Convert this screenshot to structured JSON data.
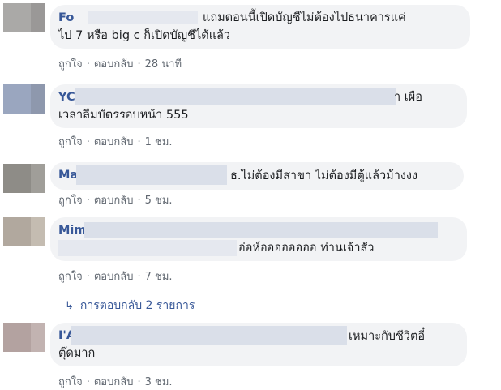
{
  "actions": {
    "like": "ถูกใจ",
    "reply": "ตอบกลับ",
    "separator": "·"
  },
  "comments": [
    {
      "author": "Fo",
      "lines": [
        "แถมตอนนี้เปิดบัญชีไม่ต้องไปธนาคารแค่",
        "ไป 7 หรือ big c ก็เปิดบัญชีได้แล้ว"
      ],
      "time": "28 นาที"
    },
    {
      "author": "YC",
      "lines": [
        "า เผื่อ",
        "เวลาลืมบัตรรอบหน้า 555"
      ],
      "time": "1 ชม."
    },
    {
      "author": "Ma",
      "lines": [
        "ธ.ไม่ต้องมีสาขา ไม่ต้องมีตู้แล้วม้างงง"
      ],
      "time": "5 ชม."
    },
    {
      "author": "Mim",
      "lines": [
        "อ่อห์ออออออออ ท่านเจ้าสัว"
      ],
      "time": "7 ชม."
    },
    {
      "author": "I'A",
      "lines": [
        "เหมาะกับชีวิตอี๋",
        "ตุ๊ดมาก"
      ],
      "time": "3 ชม."
    }
  ],
  "replies_link": "การตอบกลับ 2 รายการ"
}
